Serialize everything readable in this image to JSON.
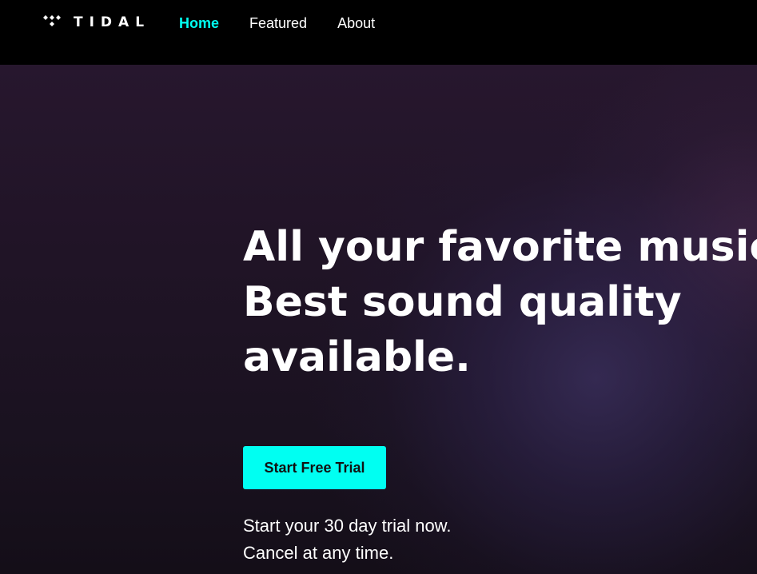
{
  "brand": {
    "name": "TIDAL",
    "icon": "tidal-logo-icon",
    "accent_color": "#00fff2"
  },
  "navigation": {
    "items": [
      {
        "label": "Home",
        "active": true
      },
      {
        "label": "Featured",
        "active": false
      },
      {
        "label": "About",
        "active": false
      }
    ]
  },
  "hero": {
    "headline_lines": [
      "All your favorite music.",
      "Best sound quality",
      "available."
    ],
    "cta_label": "Start Free Trial",
    "trial_lines": [
      "Start your 30 day trial now.",
      "Cancel at any time."
    ]
  }
}
